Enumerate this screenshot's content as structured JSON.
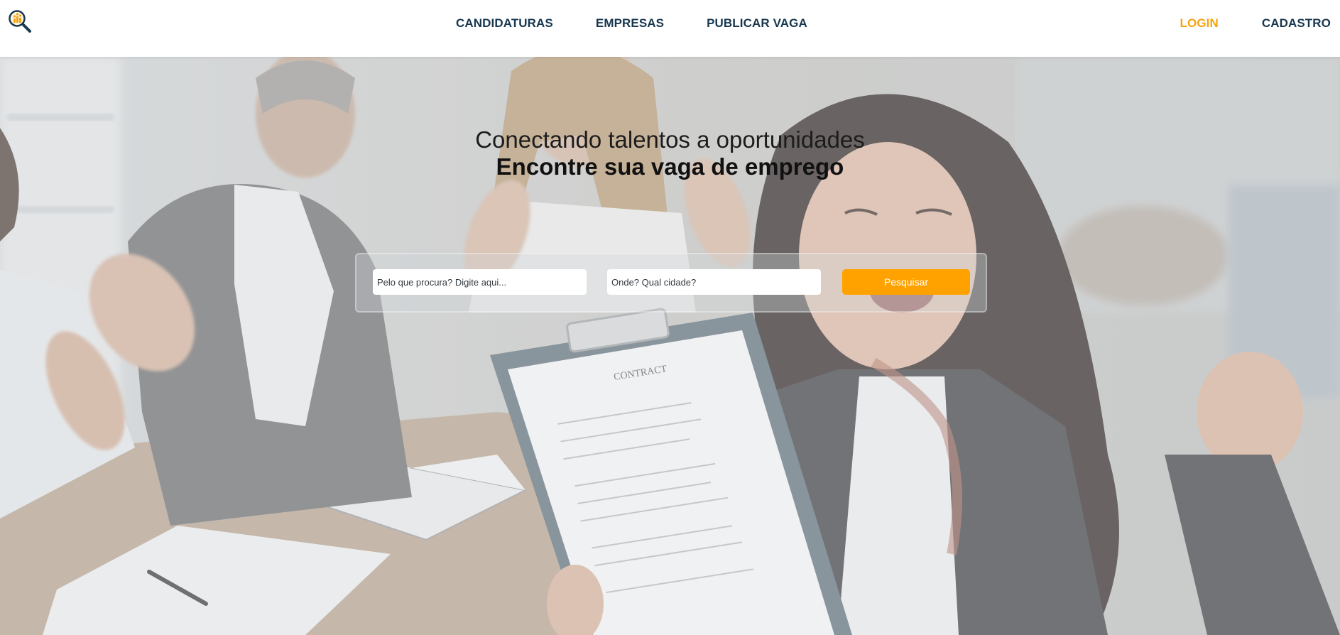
{
  "header": {
    "logo_icon": "magnifier-people-logo-icon",
    "nav": [
      {
        "label": "CANDIDATURAS"
      },
      {
        "label": "EMPRESAS"
      },
      {
        "label": "PUBLICAR VAGA"
      }
    ],
    "login_label": "LOGIN",
    "signup_label": "CADASTRO"
  },
  "hero": {
    "tagline": "Conectando talentos a oportunidades",
    "headline": "Encontre sua vaga de emprego",
    "search": {
      "what_placeholder": "Pelo que procura? Digite aqui...",
      "where_placeholder": "Onde? Qual cidade?",
      "button_label": "Pesquisar"
    }
  },
  "colors": {
    "brand_dark": "#17374f",
    "accent_orange": "#ffa200",
    "login_orange": "#f5a30e"
  }
}
